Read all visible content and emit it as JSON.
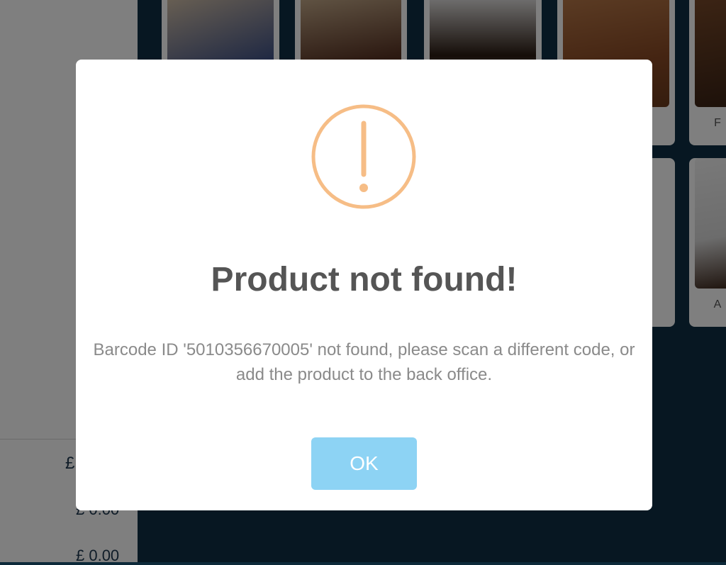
{
  "background": {
    "totals": [
      "£",
      "£ 0.00",
      "£ 0.00"
    ],
    "tile_labels": [
      "F",
      "A"
    ]
  },
  "dialog": {
    "icon": "warning-icon",
    "title": "Product not found!",
    "message": "Barcode ID '5010356670005' not found, please scan a different code, or add the product to the back office.",
    "ok_label": "OK"
  },
  "colors": {
    "icon_orange": "#f6bd86",
    "ok_button": "#8dd3f4",
    "title_text": "#555555",
    "message_text": "#8a8a8a"
  }
}
